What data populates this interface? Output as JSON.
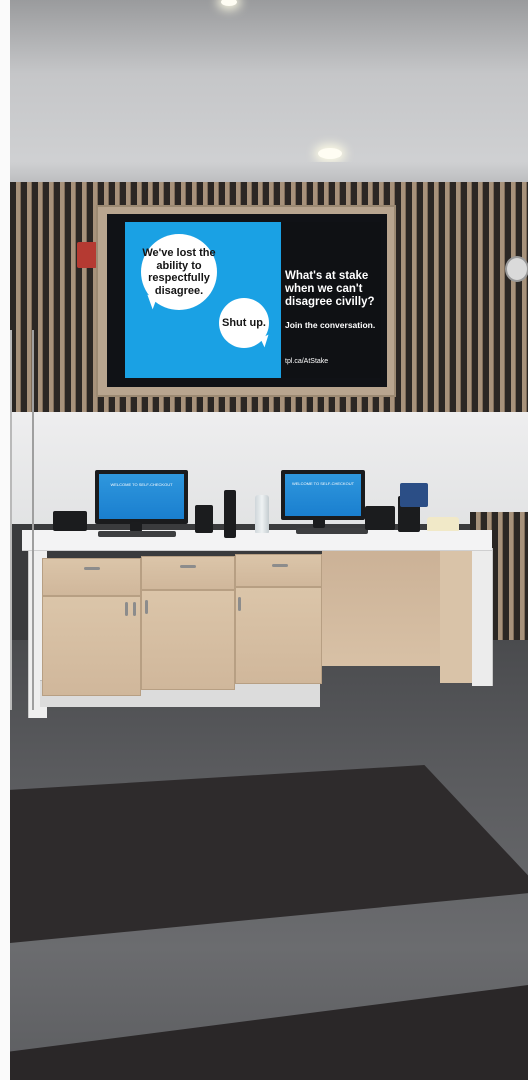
{
  "scene": {
    "description_free": true,
    "display_screen": {
      "bubble_left": "We've lost the ability to respectfully disagree.",
      "bubble_right": "Shut up.",
      "headline": "What's at stake when we can't disagree civilly?",
      "subline": "Join the conversation.",
      "url": "tpl.ca/AtStake"
    },
    "kiosk_screen_text": "WELCOME TO SELF-CHECKOUT",
    "colors": {
      "screen_blue": "#1aa1e4",
      "screen_dark": "#0f1114",
      "cabinet_wood": "#d6bfa3",
      "floor": "#5a5b5e"
    }
  }
}
